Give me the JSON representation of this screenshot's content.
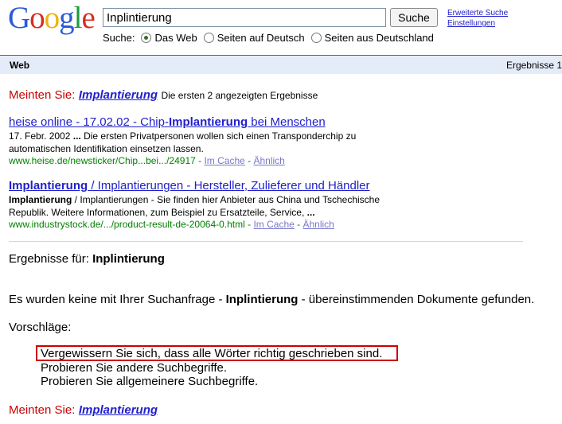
{
  "logo": "Google",
  "search": {
    "value": "Inplintierung",
    "button": "Suche"
  },
  "header_links": [
    "Erweiterte Suche",
    "Einstellungen"
  ],
  "radio_row": {
    "label": "Suche:",
    "options": [
      "Das Web",
      "Seiten auf Deutsch",
      "Seiten aus Deutschland"
    ],
    "selected": "Das Web"
  },
  "bar": {
    "tab": "Web",
    "count": "Ergebnisse 1"
  },
  "did_you_mean_top": {
    "prefix": "Meinten Sie:",
    "term": "Implantierung",
    "note": "Die ersten 2 angezeigten Ergebnisse"
  },
  "results": [
    {
      "title_a": "heise online - 17.02.02 - Chip-",
      "title_b": "Implantierung",
      "title_c": " bei Menschen",
      "snippet_1": "17. Febr. 2002 ",
      "snippet_1b": "...",
      "snippet_1c": " Die ersten Privatpersonen wollen sich einen Transponderchip zu",
      "snippet_2": "automatischen Identifikation einsetzen lassen.",
      "url": "www.heise.de/newsticker/Chip...bei.../24917",
      "cache": "Im Cache",
      "similar": "Ähnlich"
    },
    {
      "title_a": "",
      "title_b": "Implantierung",
      "title_c": " / Implantierungen - Hersteller, Zulieferer und Händler",
      "snippet_1": "Implantierung",
      "snippet_1b": "",
      "snippet_1c": " / Implantierungen - Sie finden hier Anbieter aus China und Tschechische",
      "snippet_2": "Republik. Weitere Informationen, zum Beispiel zu Ersatzteile, Service, ",
      "snippet_2b": "...",
      "url": "www.industrystock.de/.../product-result-de-20064-0.html",
      "cache": "Im Cache",
      "similar": "Ähnlich"
    }
  ],
  "results_for": {
    "prefix": "Ergebnisse für: ",
    "term": "Inplintierung"
  },
  "no_results": {
    "a": "Es wurden keine mit Ihrer Suchanfrage - ",
    "term": "Inplintierung",
    "b": " - übereinstimmenden Dokumente gefunden."
  },
  "suggestions_label": "Vorschläge:",
  "suggestions": [
    "Vergewissern Sie sich, dass alle Wörter richtig geschrieben sind.",
    "Probieren Sie andere Suchbegriffe.",
    "Probieren Sie allgemeinere Suchbegriffe."
  ],
  "did_you_mean_bottom": {
    "prefix": "Meinten Sie:",
    "term": "Implantierung"
  },
  "highlight_color": "#cc0000"
}
